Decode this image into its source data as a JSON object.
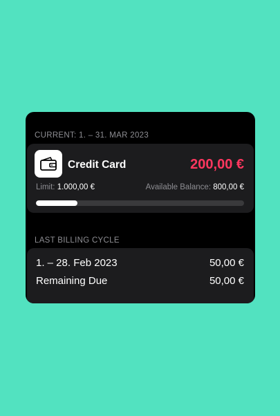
{
  "current": {
    "header": "CURRENT: 1. – 31. MAR 2023",
    "card_title": "Credit Card",
    "amount": "200,00 €",
    "limit_label": "Limit:",
    "limit_value": "1.000,00 €",
    "available_label": "Available Balance:",
    "available_value": "800,00 €",
    "usage_fraction": 0.2,
    "icon": "wallet-icon"
  },
  "last_cycle": {
    "header": "LAST BILLING CYCLE",
    "rows": [
      {
        "label": "1. – 28. Feb 2023",
        "value": "50,00 €"
      },
      {
        "label": "Remaining Due",
        "value": "50,00 €"
      }
    ]
  },
  "colors": {
    "background": "#52e2c0",
    "panel": "#000000",
    "card": "#1c1c1e",
    "amount": "#ff375f",
    "secondary_text": "#8e8e93"
  }
}
